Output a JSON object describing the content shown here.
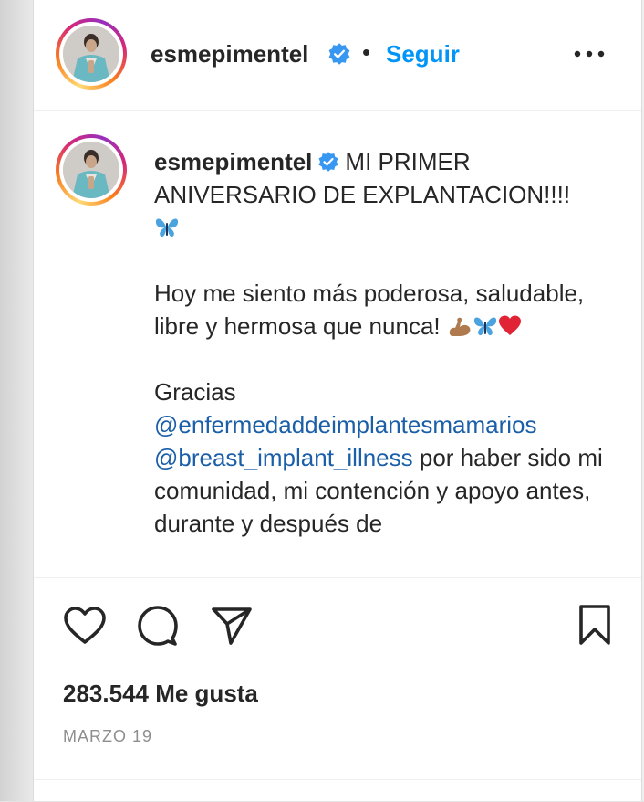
{
  "header": {
    "username": "esmepimentel",
    "separator": "•",
    "follow_label": "Seguir"
  },
  "caption": {
    "username": "esmepimentel",
    "headline": "MI PRIMER ANIVERSARIO DE EXPLANTACION!!!!",
    "line2": "Hoy me siento más poderosa, saludable, libre y hermosa que nunca!",
    "thanks": "Gracias",
    "mention1": "@enfermedaddeimplantesmamarios",
    "mention2": "@breast_implant_illness",
    "rest": "por haber sido mi comunidad, mi contención y apoyo antes, durante y después de"
  },
  "likes_text": "283.544 Me gusta",
  "date_text": "MARZO 19",
  "colors": {
    "accent": "#0095f6",
    "mention": "#1a5fa8",
    "verified": "#3897f0",
    "text": "#262626",
    "muted": "#8e8e8e"
  },
  "icons": [
    "verified-badge-icon",
    "more-options-icon",
    "heart-icon",
    "comment-icon",
    "share-icon",
    "bookmark-icon",
    "butterfly-emoji",
    "flexed-biceps-emoji",
    "red-heart-emoji"
  ]
}
